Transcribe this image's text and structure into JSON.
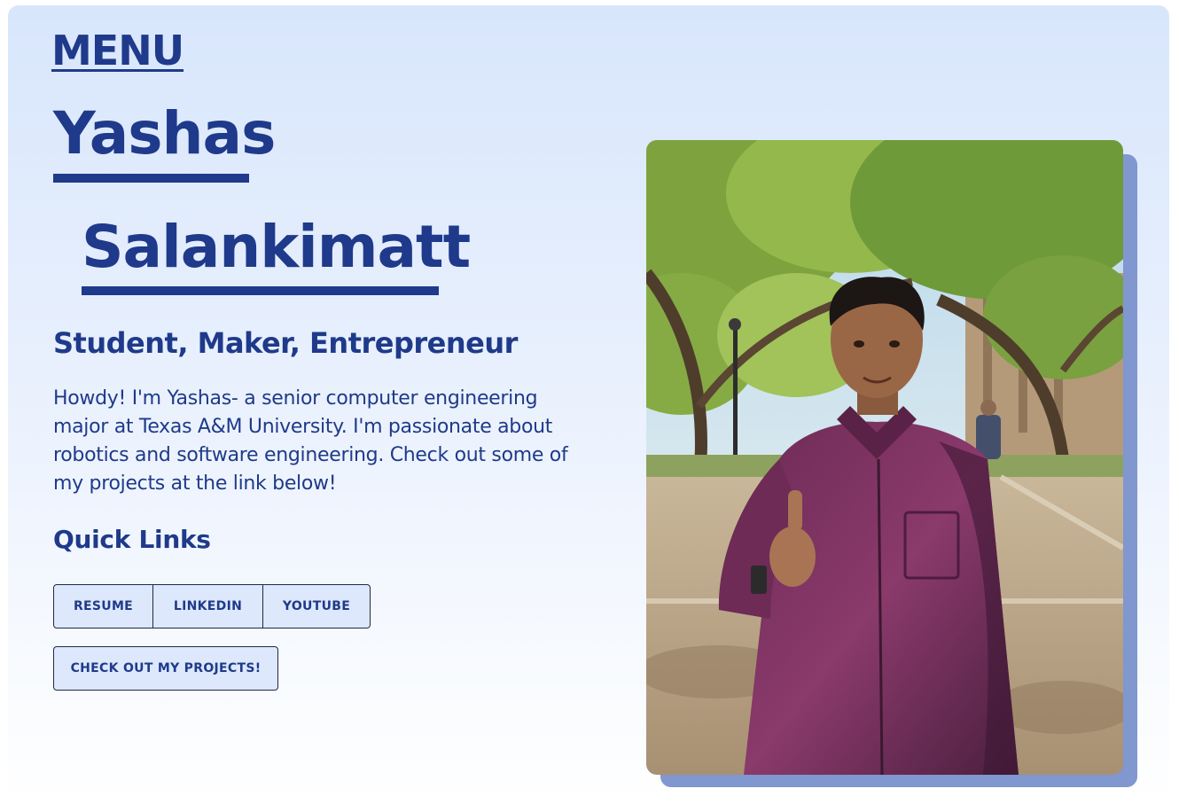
{
  "nav": {
    "menu_label": "MENU"
  },
  "hero": {
    "first_name": "Yashas",
    "last_name": "Salankimatt",
    "tagline": "Student, Maker, Entrepreneur",
    "bio": "Howdy! I'm Yashas- a senior computer engineering major at Texas A&M University. I'm passionate about robotics and software engineering. Check out some of my projects at the link below!"
  },
  "quick_links": {
    "title": "Quick Links",
    "buttons": [
      {
        "label": "RESUME"
      },
      {
        "label": "LINKEDIN"
      },
      {
        "label": "YOUTUBE"
      }
    ],
    "projects_label": "CHECK OUT MY PROJECTS!"
  },
  "colors": {
    "primary": "#1f3a8a",
    "button_bg": "#dde8fc",
    "shadow": "#8097cf"
  }
}
